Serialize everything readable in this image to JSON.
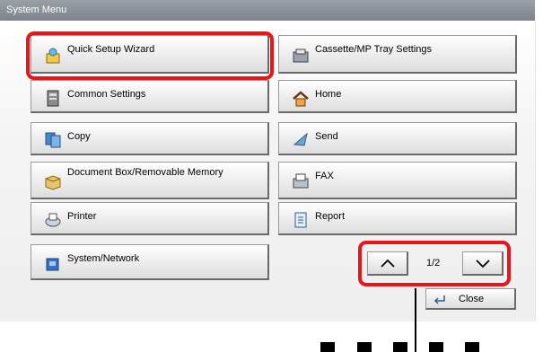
{
  "window": {
    "title": "System Menu"
  },
  "menu": {
    "left": [
      {
        "label": "Quick Setup Wizard",
        "icon": "wizard-icon"
      },
      {
        "label": "Common Settings",
        "icon": "settings-device-icon"
      },
      {
        "label": "Copy",
        "icon": "copy-icon"
      },
      {
        "label": "Document Box/Removable Memory",
        "icon": "document-box-icon"
      },
      {
        "label": "Printer",
        "icon": "printer-icon"
      },
      {
        "label": "System/Network",
        "icon": "system-network-icon"
      }
    ],
    "right": [
      {
        "label": "Cassette/MP Tray Settings",
        "icon": "cassette-icon"
      },
      {
        "label": "Home",
        "icon": "home-icon"
      },
      {
        "label": "Send",
        "icon": "send-icon"
      },
      {
        "label": "FAX",
        "icon": "fax-icon"
      },
      {
        "label": "Report",
        "icon": "report-icon"
      }
    ]
  },
  "pagination": {
    "page": "1/2",
    "up_icon": "chevron-up-icon",
    "down_icon": "chevron-down-icon"
  },
  "close": {
    "label": "Close",
    "icon": "return-arrow-icon"
  },
  "colors": {
    "highlight": "#e8151b",
    "titlebar": "#8a9098"
  }
}
